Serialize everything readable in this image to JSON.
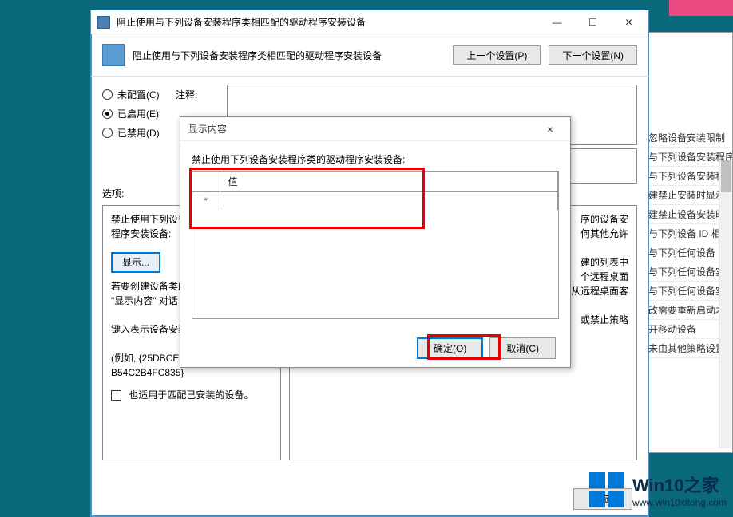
{
  "main_window": {
    "title": "阻止使用与下列设备安装程序类相匹配的驱动程序安装设备",
    "header_text": "阻止使用与下列设备安装程序类相匹配的驱动程序安装设备",
    "prev_btn": "上一个设置(P)",
    "next_btn": "下一个设置(N)",
    "radios": {
      "not_configured": "未配置(C)",
      "enabled": "已启用(E)",
      "disabled": "已禁用(D)"
    },
    "comment_label": "注释:",
    "options_label": "选项:",
    "left_box_lines": [
      "禁止使用下列设备安装程序类的驱动程序安装设备:",
      "",
      "若要创建设备类的列表中",
      "\"显示内容\" 对话",
      "",
      "键入表示设备安装",
      "",
      "(例如, {25DBCE",
      "B54C2B4FC835}"
    ],
    "show_button": "显示...",
    "checkbox_label": "也适用于匹配已安装的设备。",
    "right_box_lines": [
      "序的设备安",
      "何其他允许",
      "",
      "建的列表中",
      "个远程桌面",
      "从远程桌面客",
      "",
      "或禁止策略"
    ],
    "footer": {
      "ok": "确定"
    }
  },
  "modal": {
    "title": "显示内容",
    "message": "禁止使用下列设备安装程序类的驱动程序安装设备:",
    "table": {
      "col1": "",
      "col2": "值",
      "row_marker": "*"
    },
    "ok_btn": "确定(O)",
    "cancel_btn": "取消(C)",
    "close_x": "×"
  },
  "right_panel_lines": [
    "忽略设备安装限制",
    "与下列设备安装程序",
    "与下列设备安装程序",
    "建禁止安装时显示自",
    "建禁止设备安装时显",
    "与下列设备 ID 相匹",
    "与下列任何设备 ID ",
    "与下列任何设备实例",
    "与下列任何设备实例",
    "改需要重新启动才能",
    "开移动设备",
    "未由其他策略设置描"
  ],
  "watermark": {
    "brand1": "Win10",
    "brand2": "之家",
    "url": "www.win10xitong.com"
  },
  "win_controls": {
    "min": "—",
    "max": "☐",
    "close": "✕"
  }
}
